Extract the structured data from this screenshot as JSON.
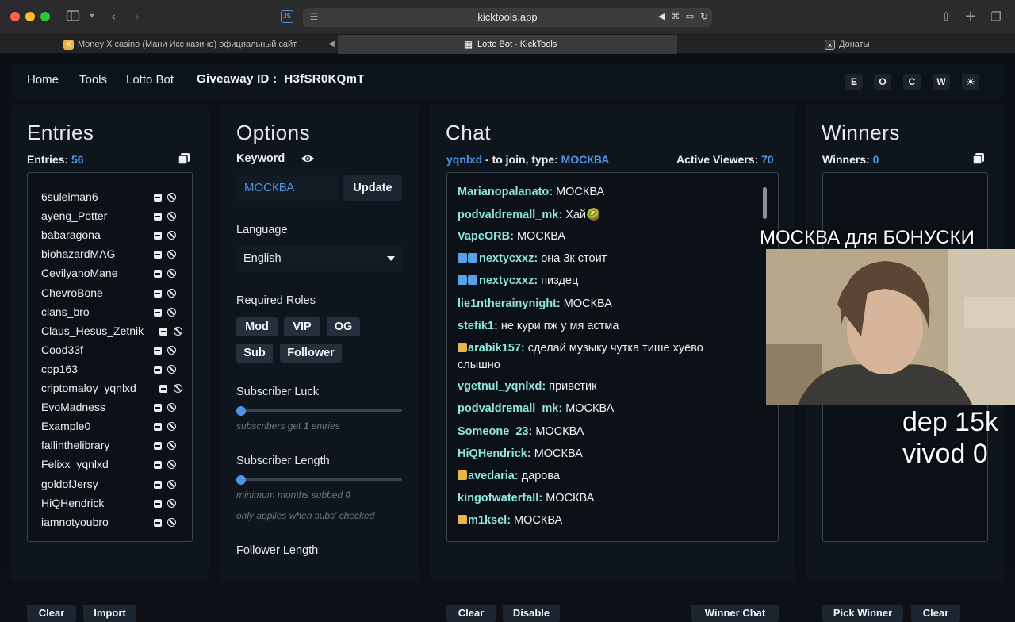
{
  "browser": {
    "url": "kicktools.app",
    "js_badge": "JS",
    "tabs": [
      {
        "title": "Money X casino (Мани Икс казино) официальный сайт"
      },
      {
        "title": "Lotto Bot - KickTools"
      },
      {
        "title": "Донаты"
      }
    ]
  },
  "nav": {
    "home": "Home",
    "tools": "Tools",
    "lotto_bot": "Lotto Bot",
    "giveaway_label": "Giveaway ID :",
    "giveaway_id": "H3fSR0KQmT",
    "buttons": [
      "E",
      "O",
      "C",
      "W"
    ],
    "theme_icon": "sun-icon"
  },
  "entries": {
    "title": "Entries",
    "count_label": "Entries:",
    "count": "56",
    "list": [
      "6suleiman6",
      "ayeng_Potter",
      "babaragona",
      "biohazardMAG",
      "CevilyanoMane",
      "ChevroBone",
      "clans_bro",
      "Claus_Hesus_Zetnik",
      "Cood33f",
      "cpp163",
      "criptomaloy_yqnlxd",
      "EvoMadness",
      "Example0",
      "fallinthelibrary",
      "Felixx_yqnlxd",
      "goldofJersy",
      "HiQHendrick",
      "iamnotyoubro"
    ],
    "bottom_buttons": [
      "Clear",
      "Import"
    ]
  },
  "options": {
    "title": "Options",
    "keyword_label": "Keyword",
    "keyword_value": "МОСКВА",
    "update_button": "Update",
    "language_label": "Language",
    "language_value": "English",
    "roles_label": "Required Roles",
    "roles": [
      "Mod",
      "VIP",
      "OG",
      "Sub",
      "Follower"
    ],
    "sub_luck_label": "Subscriber Luck",
    "sub_luck_hint_pre": "subscribers get ",
    "sub_luck_value": "1",
    "sub_luck_hint_post": " entries",
    "sub_length_label": "Subscriber Length",
    "sub_length_hint_pre": "minimum months subbed ",
    "sub_length_value": "0",
    "sub_length_hint2": "only applies when subs' checked",
    "follower_length_label": "Follower Length"
  },
  "chat": {
    "title": "Chat",
    "channel": "yqnlxd",
    "join_text": " - to join, type: ",
    "keyword": "МОСКВА",
    "viewers_label": "Active Viewers:",
    "viewers": "70",
    "messages": [
      {
        "user": "Marianopalanato",
        "text": "МОСКВА",
        "badge": ""
      },
      {
        "user": "podvaldremall_mk",
        "text": "Хай🥝",
        "badge": ""
      },
      {
        "user": "VapeORB",
        "text": "МОСКВА",
        "badge": ""
      },
      {
        "user": "nextycxxz",
        "text": "она 3к стоит",
        "badge": "blue"
      },
      {
        "user": "nextycxxz",
        "text": "пиздец",
        "badge": "blue"
      },
      {
        "user": "lie1ntherainynight",
        "text": "МОСКВА",
        "badge": ""
      },
      {
        "user": "stefik1",
        "text": "не кури пж у мя астма",
        "badge": ""
      },
      {
        "user": "arabik157",
        "text": "сделай музыку чутка тише хуёво",
        "text2": "слышно",
        "badge": "gold"
      },
      {
        "user": "vgetnul_yqnlxd",
        "text": "приветик",
        "badge": ""
      },
      {
        "user": "podvaldremall_mk",
        "text": "МОСКВА",
        "badge": ""
      },
      {
        "user": "Someone_23",
        "text": "МОСКВА",
        "badge": ""
      },
      {
        "user": "HiQHendrick",
        "text": "МОСКВА",
        "badge": ""
      },
      {
        "user": "avedaria",
        "text": "дарова",
        "badge": "gold"
      },
      {
        "user": "kingofwaterfall",
        "text": "МОСКВА",
        "badge": ""
      },
      {
        "user": "m1ksel",
        "text": "МОСКВА",
        "badge": "gold"
      }
    ],
    "bottom_buttons": [
      "Clear",
      "Disable",
      "Winner Chat"
    ]
  },
  "winners": {
    "title": "Winners",
    "count_label": "Winners:",
    "count": "0",
    "bottom_buttons": [
      "Pick Winner",
      "Clear"
    ]
  },
  "stream_overlay": {
    "top_text": "МОСКВА для БОНУСКИ",
    "dep_text": "dep 15k",
    "vivod_text": "vivod 0"
  }
}
